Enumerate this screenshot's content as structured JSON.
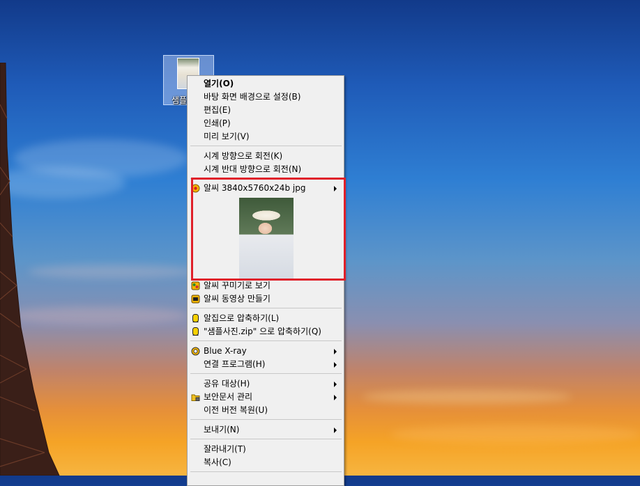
{
  "desktop": {
    "icon_label": "샘플"
  },
  "menu": {
    "group1": [
      "열기(O)",
      "바탕 화면 배경으로 설정(B)",
      "편집(E)",
      "인쇄(P)",
      "미리 보기(V)"
    ],
    "group2": [
      "시계 방향으로 회전(K)",
      "시계 반대 방향으로 회전(N)"
    ],
    "alsee_preview": "알씨 3840x5760x24b jpg",
    "group3": [
      "알씨 꾸미기로 보기",
      "알씨 동영상 만들기"
    ],
    "group4": [
      "알집으로 압축하기(L)",
      "\"샘플사진.zip\" 으로 압축하기(Q)"
    ],
    "group5": [
      "Blue X-ray",
      "연결 프로그램(H)"
    ],
    "group6": [
      "공유 대상(H)",
      "보안문서 관리",
      "이전 버전 복원(U)"
    ],
    "group7": [
      "보내기(N)"
    ],
    "group8": [
      "잘라내기(T)",
      "복사(C)"
    ]
  },
  "colors": {
    "highlight_border": "#e0202a",
    "menu_bg": "#f0f0f0"
  }
}
